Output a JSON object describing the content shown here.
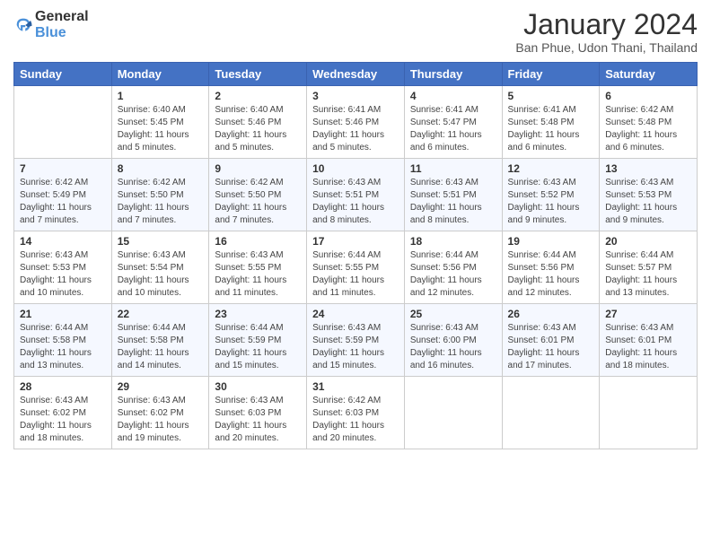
{
  "header": {
    "logo": {
      "text_general": "General",
      "text_blue": "Blue"
    },
    "title": "January 2024",
    "subtitle": "Ban Phue, Udon Thani, Thailand"
  },
  "weekdays": [
    "Sunday",
    "Monday",
    "Tuesday",
    "Wednesday",
    "Thursday",
    "Friday",
    "Saturday"
  ],
  "weeks": [
    [
      {
        "day": "",
        "info": ""
      },
      {
        "day": "1",
        "info": "Sunrise: 6:40 AM\nSunset: 5:45 PM\nDaylight: 11 hours\nand 5 minutes."
      },
      {
        "day": "2",
        "info": "Sunrise: 6:40 AM\nSunset: 5:46 PM\nDaylight: 11 hours\nand 5 minutes."
      },
      {
        "day": "3",
        "info": "Sunrise: 6:41 AM\nSunset: 5:46 PM\nDaylight: 11 hours\nand 5 minutes."
      },
      {
        "day": "4",
        "info": "Sunrise: 6:41 AM\nSunset: 5:47 PM\nDaylight: 11 hours\nand 6 minutes."
      },
      {
        "day": "5",
        "info": "Sunrise: 6:41 AM\nSunset: 5:48 PM\nDaylight: 11 hours\nand 6 minutes."
      },
      {
        "day": "6",
        "info": "Sunrise: 6:42 AM\nSunset: 5:48 PM\nDaylight: 11 hours\nand 6 minutes."
      }
    ],
    [
      {
        "day": "7",
        "info": "Sunrise: 6:42 AM\nSunset: 5:49 PM\nDaylight: 11 hours\nand 7 minutes."
      },
      {
        "day": "8",
        "info": "Sunrise: 6:42 AM\nSunset: 5:50 PM\nDaylight: 11 hours\nand 7 minutes."
      },
      {
        "day": "9",
        "info": "Sunrise: 6:42 AM\nSunset: 5:50 PM\nDaylight: 11 hours\nand 7 minutes."
      },
      {
        "day": "10",
        "info": "Sunrise: 6:43 AM\nSunset: 5:51 PM\nDaylight: 11 hours\nand 8 minutes."
      },
      {
        "day": "11",
        "info": "Sunrise: 6:43 AM\nSunset: 5:51 PM\nDaylight: 11 hours\nand 8 minutes."
      },
      {
        "day": "12",
        "info": "Sunrise: 6:43 AM\nSunset: 5:52 PM\nDaylight: 11 hours\nand 9 minutes."
      },
      {
        "day": "13",
        "info": "Sunrise: 6:43 AM\nSunset: 5:53 PM\nDaylight: 11 hours\nand 9 minutes."
      }
    ],
    [
      {
        "day": "14",
        "info": "Sunrise: 6:43 AM\nSunset: 5:53 PM\nDaylight: 11 hours\nand 10 minutes."
      },
      {
        "day": "15",
        "info": "Sunrise: 6:43 AM\nSunset: 5:54 PM\nDaylight: 11 hours\nand 10 minutes."
      },
      {
        "day": "16",
        "info": "Sunrise: 6:43 AM\nSunset: 5:55 PM\nDaylight: 11 hours\nand 11 minutes."
      },
      {
        "day": "17",
        "info": "Sunrise: 6:44 AM\nSunset: 5:55 PM\nDaylight: 11 hours\nand 11 minutes."
      },
      {
        "day": "18",
        "info": "Sunrise: 6:44 AM\nSunset: 5:56 PM\nDaylight: 11 hours\nand 12 minutes."
      },
      {
        "day": "19",
        "info": "Sunrise: 6:44 AM\nSunset: 5:56 PM\nDaylight: 11 hours\nand 12 minutes."
      },
      {
        "day": "20",
        "info": "Sunrise: 6:44 AM\nSunset: 5:57 PM\nDaylight: 11 hours\nand 13 minutes."
      }
    ],
    [
      {
        "day": "21",
        "info": "Sunrise: 6:44 AM\nSunset: 5:58 PM\nDaylight: 11 hours\nand 13 minutes."
      },
      {
        "day": "22",
        "info": "Sunrise: 6:44 AM\nSunset: 5:58 PM\nDaylight: 11 hours\nand 14 minutes."
      },
      {
        "day": "23",
        "info": "Sunrise: 6:44 AM\nSunset: 5:59 PM\nDaylight: 11 hours\nand 15 minutes."
      },
      {
        "day": "24",
        "info": "Sunrise: 6:43 AM\nSunset: 5:59 PM\nDaylight: 11 hours\nand 15 minutes."
      },
      {
        "day": "25",
        "info": "Sunrise: 6:43 AM\nSunset: 6:00 PM\nDaylight: 11 hours\nand 16 minutes."
      },
      {
        "day": "26",
        "info": "Sunrise: 6:43 AM\nSunset: 6:01 PM\nDaylight: 11 hours\nand 17 minutes."
      },
      {
        "day": "27",
        "info": "Sunrise: 6:43 AM\nSunset: 6:01 PM\nDaylight: 11 hours\nand 18 minutes."
      }
    ],
    [
      {
        "day": "28",
        "info": "Sunrise: 6:43 AM\nSunset: 6:02 PM\nDaylight: 11 hours\nand 18 minutes."
      },
      {
        "day": "29",
        "info": "Sunrise: 6:43 AM\nSunset: 6:02 PM\nDaylight: 11 hours\nand 19 minutes."
      },
      {
        "day": "30",
        "info": "Sunrise: 6:43 AM\nSunset: 6:03 PM\nDaylight: 11 hours\nand 20 minutes."
      },
      {
        "day": "31",
        "info": "Sunrise: 6:42 AM\nSunset: 6:03 PM\nDaylight: 11 hours\nand 20 minutes."
      },
      {
        "day": "",
        "info": ""
      },
      {
        "day": "",
        "info": ""
      },
      {
        "day": "",
        "info": ""
      }
    ]
  ]
}
